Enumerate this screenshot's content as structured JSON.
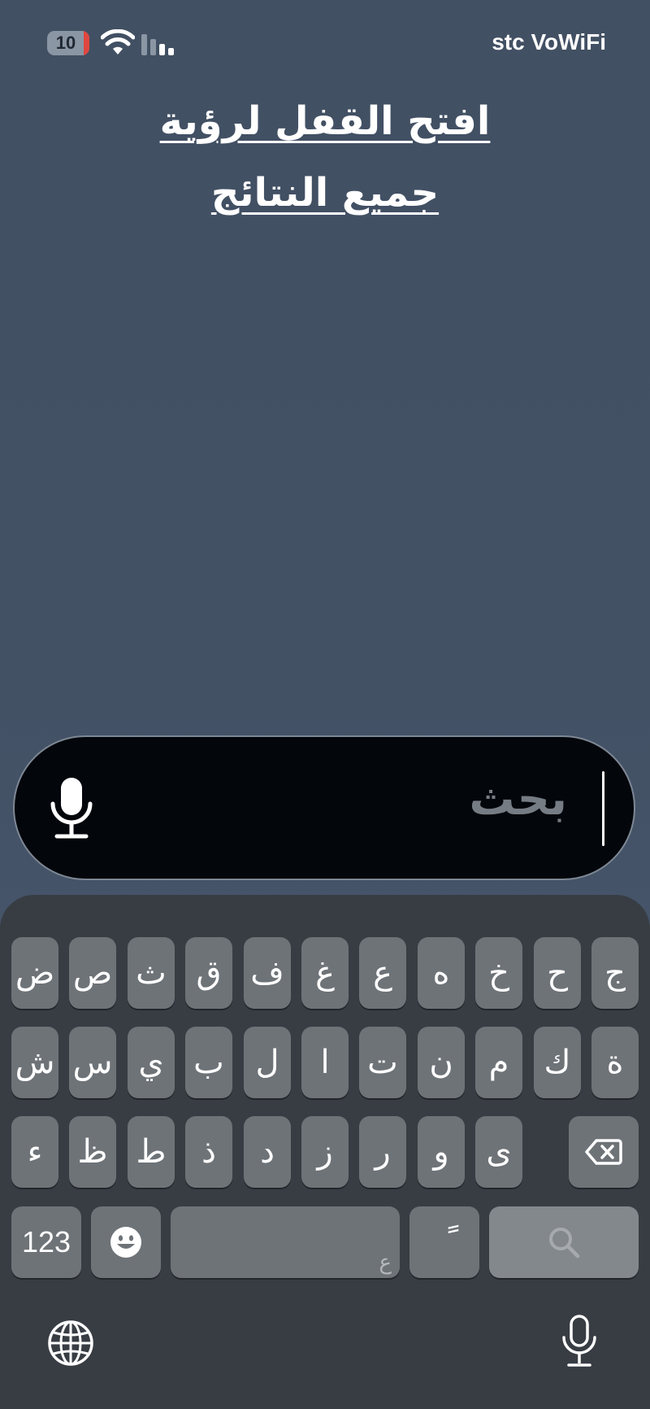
{
  "status_bar": {
    "battery_level": "10",
    "carrier": "stc VoWiFi",
    "icons": [
      "battery-icon",
      "wifi-icon",
      "cellular-signal-icon"
    ]
  },
  "lock_message": {
    "line1": "افتح القفل لرؤية",
    "line2": "جميع النتائج"
  },
  "search": {
    "placeholder": "بحث",
    "icon": "microphone-icon"
  },
  "keyboard": {
    "row1": [
      "ض",
      "ص",
      "ث",
      "ق",
      "ف",
      "غ",
      "ع",
      "ه",
      "خ",
      "ح",
      "ج"
    ],
    "row2": [
      "ش",
      "س",
      "ي",
      "ب",
      "ل",
      "ا",
      "ت",
      "ن",
      "م",
      "ك",
      "ة"
    ],
    "row3": [
      "ء",
      "ظ",
      "ط",
      "ذ",
      "د",
      "ز",
      "ر",
      "و",
      "ى"
    ],
    "delete_icon": "delete-icon",
    "numbers_label": "123",
    "emoji_icon": "emoji-icon",
    "space_hint": "ع",
    "diacritic_key": "ً",
    "search_key_icon": "search-icon",
    "globe_icon": "globe-icon",
    "dictation_icon": "microphone-icon"
  },
  "colors": {
    "background": "#435165",
    "keyboard": "#383d44",
    "key": "#6e7378",
    "search_field": "#03060b"
  }
}
